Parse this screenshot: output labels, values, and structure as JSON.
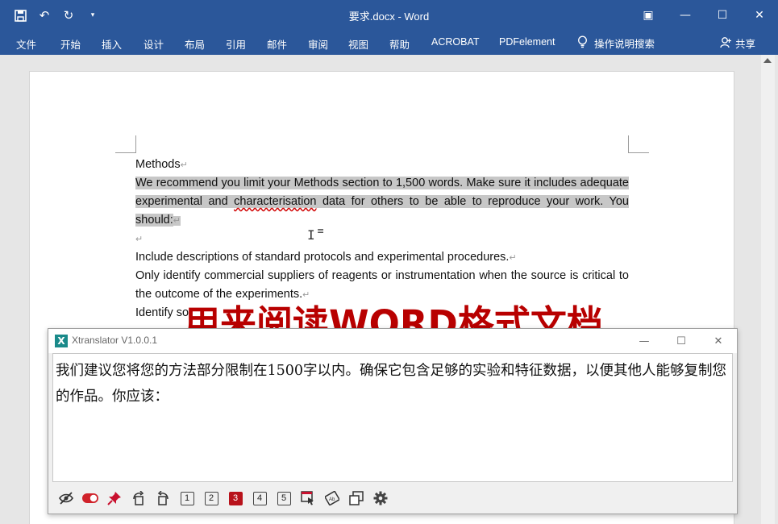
{
  "titlebar": {
    "doc_title": "要求.docx  -  Word",
    "qat_icons": [
      "save-icon",
      "undo-icon",
      "redo-icon",
      "customize-icon"
    ]
  },
  "ribbon": {
    "tabs": [
      "文件",
      "开始",
      "插入",
      "设计",
      "布局",
      "引用",
      "邮件",
      "审阅",
      "视图",
      "帮助",
      "ACROBAT",
      "PDFelement"
    ],
    "tell_me": "操作说明搜索",
    "share": "共享"
  },
  "document": {
    "heading": "Methods",
    "para1_a": "We recommend you limit your Methods section to 1,500 words. Make sure it includes adequate experimental and ",
    "para1_sq": "characterisation",
    "para1_b": " data for others to be able to reproduce your work. You should:",
    "line1": "Include descriptions of standard protocols and experimental procedures.",
    "line2": "Only identify commercial suppliers of reagents or instrumentation when the source is critical to the outcome of the experiments.",
    "line3": "Identify so",
    "pilcrow": "↵"
  },
  "overlay_caption": "用来阅读WORD格式文档",
  "translator": {
    "title": "Xtranslator V1.0.0.1",
    "text": "我们建议您将您的方法部分限制在1500字以内。确保它包含足够的实验和特征数据，以便其他人能够复制您的作品。你应该：",
    "numbers": [
      "1",
      "2",
      "3",
      "4",
      "5"
    ],
    "active_number": "3",
    "accent": "#b8121b"
  },
  "colors": {
    "ribbon": "#2b579a",
    "highlight": "#c7c7c7",
    "overlay": "#b80000"
  }
}
